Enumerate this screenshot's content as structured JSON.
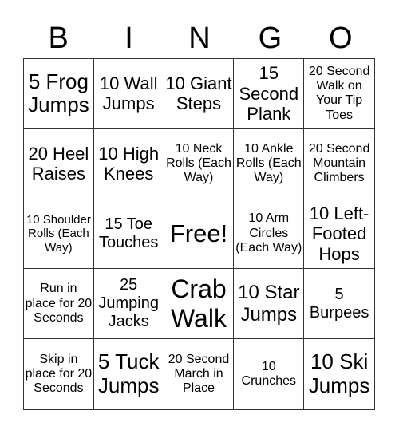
{
  "header": {
    "letters": [
      "B",
      "I",
      "N",
      "G",
      "O"
    ]
  },
  "cells": [
    "5 Frog Jumps",
    "10 Wall Jumps",
    "10 Giant Steps",
    "15 Second Plank",
    "20 Second Walk on Your Tip Toes",
    "20 Heel Raises",
    "10 High Knees",
    "10 Neck Rolls (Each Way)",
    "10 Ankle Rolls (Each Way)",
    "20 Second Mountain Climbers",
    "10 Shoulder Rolls (Each Way)",
    "15 Toe Touches",
    "Free!",
    "10 Arm Circles (Each Way)",
    "10 Left-Footed Hops",
    "Run in place for 20 Seconds",
    "25 Jumping Jacks",
    "Crab Walk",
    "10 Star Jumps",
    "5 Burpees",
    "Skip in place for 20 Seconds",
    "5 Tuck Jumps",
    "20 Second March in Place",
    "10 Crunches",
    "10 Ski Jumps"
  ]
}
